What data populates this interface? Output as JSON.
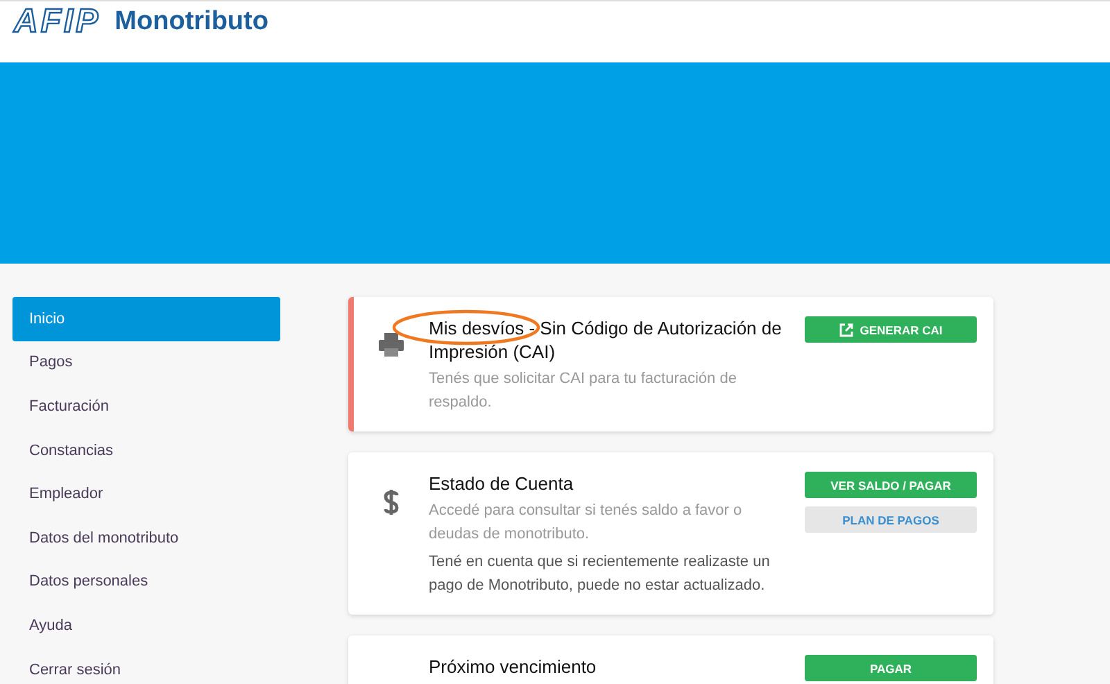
{
  "header": {
    "logo_text": "AFIP",
    "title": "Monotributo"
  },
  "sidebar": {
    "items": [
      {
        "label": "Inicio",
        "selected": true
      },
      {
        "label": "Pagos",
        "selected": false
      },
      {
        "label": "Facturación",
        "selected": false
      },
      {
        "label": "Constancias",
        "selected": false
      },
      {
        "label": "Empleador",
        "selected": false
      },
      {
        "label": "Datos del monotributo",
        "selected": false
      },
      {
        "label": "Datos personales",
        "selected": false
      },
      {
        "label": "Ayuda",
        "selected": false
      },
      {
        "label": "Cerrar sesión",
        "selected": false
      }
    ]
  },
  "cards": [
    {
      "kind": "cai",
      "alert": true,
      "circled": true,
      "title": "Mis desvíos - Sin Código de Autorización de Impresión (CAI)",
      "paragraphs": [
        {
          "kind": "muted",
          "text": "Tenés que solicitar CAI para tu facturación de respaldo."
        }
      ],
      "buttons": [
        {
          "kind": "link",
          "label": "GENERAR CAI"
        }
      ]
    },
    {
      "kind": "account",
      "alert": false,
      "circled": false,
      "title": "Estado de Cuenta",
      "paragraphs": [
        {
          "kind": "muted",
          "text": "Accedé para consultar si tenés saldo a favor o deudas de monotributo."
        },
        {
          "kind": "note",
          "text": "Tené en cuenta que si recientemente realizaste un pago de Monotributo, puede no estar actualizado."
        }
      ],
      "buttons": [
        {
          "kind": "primary",
          "label": "VER SALDO / PAGAR"
        },
        {
          "kind": "secondary",
          "label": "PLAN DE PAGOS"
        }
      ]
    },
    {
      "kind": "due",
      "alert": false,
      "circled": false,
      "title": "Próximo vencimiento",
      "buttons": [
        {
          "kind": "primary",
          "label": "PAGAR"
        }
      ]
    }
  ]
}
